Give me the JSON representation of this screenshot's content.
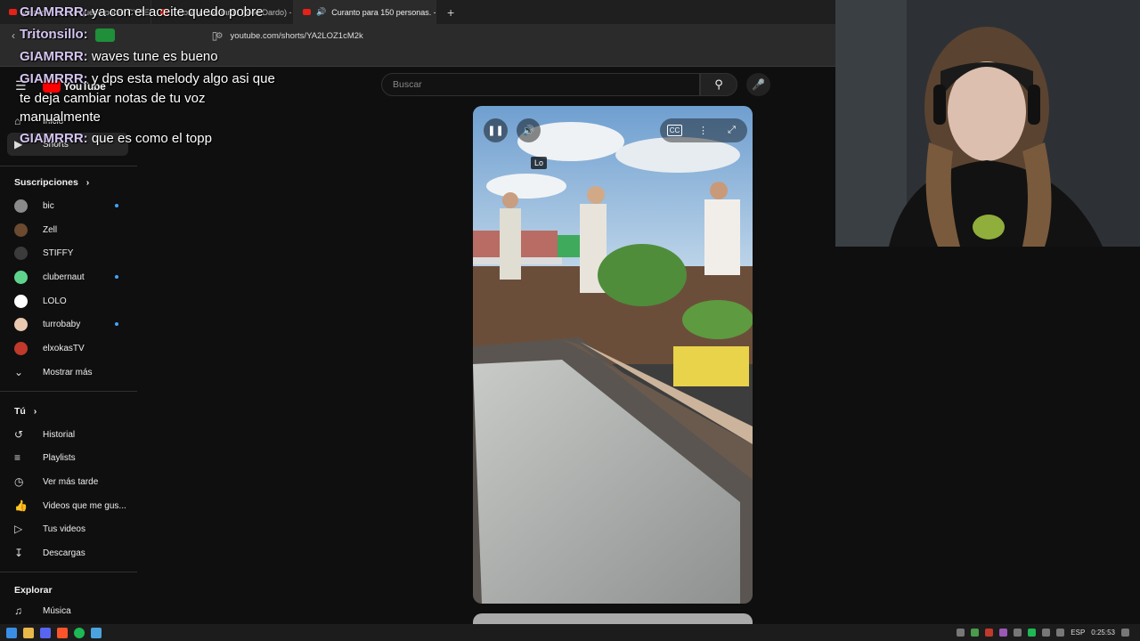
{
  "browser": {
    "tabs": [
      {
        "label": "ya con el aceite quedo pobre CYBER",
        "active": false
      },
      {
        "label": "Ahora y mas tarde (prod.Dardo) - Yo",
        "active": false
      },
      {
        "label": "Curanto para 150 personas. -",
        "active": true
      }
    ],
    "new_tab": "+",
    "url": "youtube.com/shorts/YA2LOZ1cM2k"
  },
  "youtube": {
    "logo_text": "YouTube",
    "search_placeholder": "Buscar",
    "sidebar": {
      "top_items": [
        {
          "label": "Inicio",
          "icon": "home-icon"
        },
        {
          "label": "Shorts",
          "icon": "shorts-icon"
        }
      ],
      "subscriptions_header": "Suscripciones",
      "subscriptions": [
        {
          "label": "bic",
          "avatar_color": "#8a8a8a",
          "new": true
        },
        {
          "label": "Zell",
          "avatar_color": "#6b4a2f",
          "new": false
        },
        {
          "label": "STIFFY",
          "avatar_color": "#3b3b3b",
          "new": false
        },
        {
          "label": "clubernaut",
          "avatar_color": "#5fd38c",
          "new": true
        },
        {
          "label": "LOLO",
          "avatar_color": "#ffffff",
          "new": false
        },
        {
          "label": "turrobaby",
          "avatar_color": "#e8c9b0",
          "new": true
        },
        {
          "label": "elxokasTV",
          "avatar_color": "#c0392b",
          "new": false
        }
      ],
      "show_more": "Mostrar más",
      "you_header": "Tú",
      "you_items": [
        {
          "label": "Historial",
          "icon": "history-icon"
        },
        {
          "label": "Playlists",
          "icon": "playlist-icon"
        },
        {
          "label": "Ver más tarde",
          "icon": "clock-icon"
        },
        {
          "label": "Videos que me gus...",
          "icon": "thumbs-up-icon"
        },
        {
          "label": "Tus videos",
          "icon": "video-icon"
        },
        {
          "label": "Descargas",
          "icon": "download-icon"
        }
      ],
      "explore_header": "Explorar",
      "explore_items": [
        {
          "label": "Música",
          "icon": "music-icon"
        }
      ]
    },
    "video": {
      "tooltip": "Lo",
      "cc_label": "CC"
    }
  },
  "chat": [
    {
      "user": "GIAMRRR:",
      "text": " ya con el aceite quedo pobre"
    },
    {
      "user": "Tritonsillo:",
      "text": ""
    },
    {
      "user": "GIAMRRR:",
      "text": " waves tune es bueno"
    },
    {
      "user": "GIAMRRR:",
      "text": " y dps esta melody algo asi que te deja cambiar notas de tu voz manualmente"
    },
    {
      "user": "GIAMRRR:",
      "text": " que es como el topp"
    }
  ],
  "taskbar": {
    "language": "ESP",
    "time": "0:25:53"
  },
  "colors": {
    "background": "#0f0f0f",
    "youtube_red": "#ff0000",
    "chat_username": "#d4c4f0",
    "new_dot": "#3ea6ff"
  }
}
